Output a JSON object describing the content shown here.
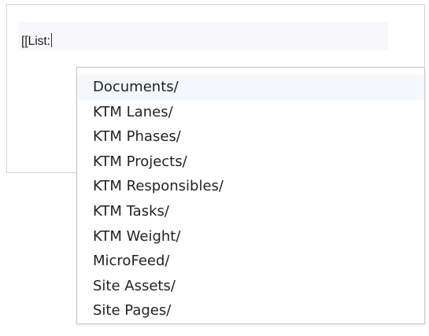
{
  "editor": {
    "text": "[[List:"
  },
  "dropdown": {
    "items": [
      "Documents/",
      "KTM Lanes/",
      "KTM Phases/",
      "KTM Projects/",
      "KTM Responsibles/",
      "KTM Tasks/",
      "KTM Weight/",
      "MicroFeed/",
      "Site Assets/",
      "Site Pages/"
    ],
    "highlighted_index": 0
  },
  "colors": {
    "text": "#222222",
    "border": "#c8c8c8",
    "highlight": "#f4f8fc"
  }
}
